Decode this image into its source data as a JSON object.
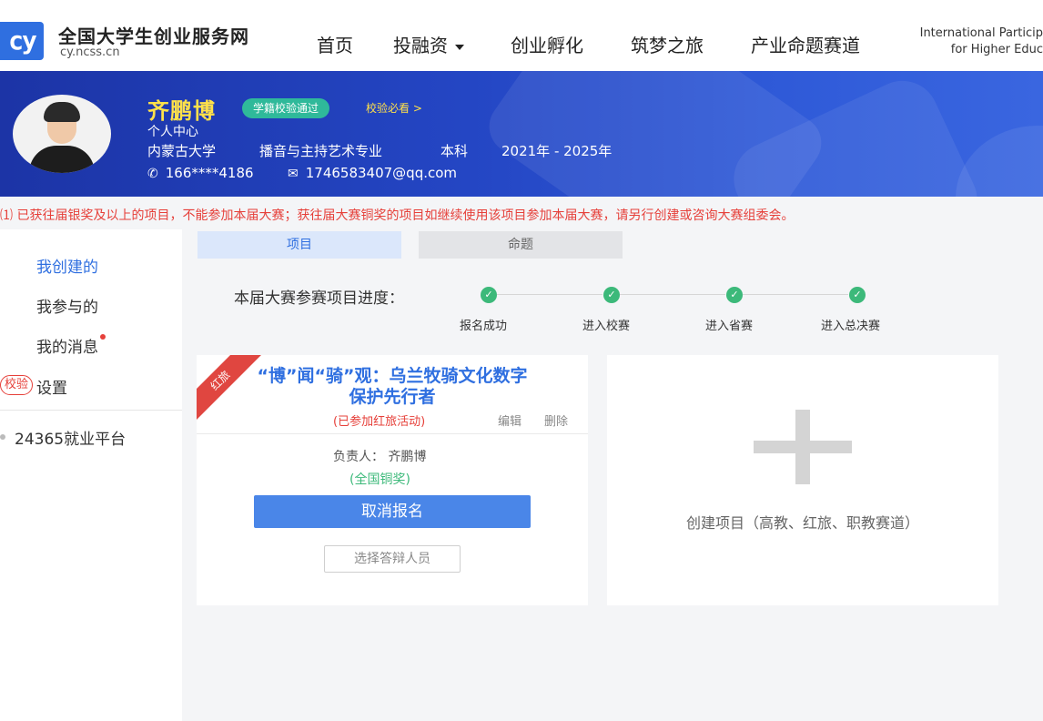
{
  "site": {
    "logo_text": "cy",
    "name": "全国大学生创业服务网",
    "domain": "cy.ncss.cn"
  },
  "nav": {
    "items": [
      "首页",
      "投融资",
      "创业孵化",
      "筑梦之旅",
      "产业命题赛道"
    ],
    "intl_line1": "International Particip",
    "intl_line2": "for Higher Educ"
  },
  "profile": {
    "name": "齐鹏博",
    "verified_badge": "学籍校验通过",
    "verify_link": "校验必看 >",
    "center_label": "个人中心",
    "school": "内蒙古大学",
    "major": "播音与主持艺术专业",
    "degree": "本科",
    "years": "2021年 - 2025年",
    "phone": "166****4186",
    "email": "1746583407@qq.com"
  },
  "warning": "⑴ 已获往届银奖及以上的项目，不能参加本届大赛；获往届大赛铜奖的项目如继续使用该项目参加本届大赛，请另行创建或咨询大赛组委会。",
  "sidebar": {
    "items": [
      "我创建的",
      "我参与的",
      "我的消息",
      "设置"
    ],
    "check_badge": "校验",
    "platform": "24365就业平台"
  },
  "tabs": [
    "项目",
    "命题"
  ],
  "progress": {
    "label": "本届大赛参赛项目进度：",
    "steps": [
      "报名成功",
      "进入校赛",
      "进入省赛",
      "进入总决赛"
    ]
  },
  "project": {
    "ribbon": "红旅",
    "title_line1": "“博”闻“骑”观：乌兰牧骑文化数字",
    "title_line2": "保护先行者",
    "status": "(已参加红旅活动)",
    "edit": "编辑",
    "delete": "删除",
    "leader": "负责人：  齐鹏博",
    "award": "(全国铜奖)",
    "cancel_btn": "取消报名",
    "select_btn": "选择答辩人员"
  },
  "create": {
    "label": "创建项目（高教、红旅、职教赛道）"
  },
  "colors": {
    "brand_blue": "#2f6fe0",
    "banner_blue": "#2446c4",
    "name_yellow": "#ffe14a",
    "warning_red": "#e6403a",
    "success_green": "#3cb97a"
  }
}
